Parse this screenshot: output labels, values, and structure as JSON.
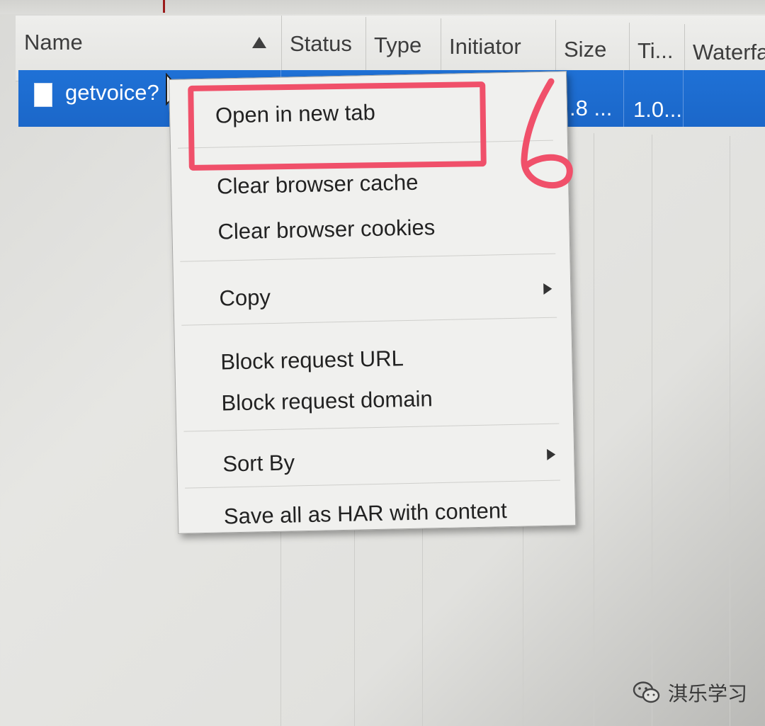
{
  "table": {
    "columns": [
      {
        "key": "name",
        "label": "Name"
      },
      {
        "key": "status",
        "label": "Status"
      },
      {
        "key": "type",
        "label": "Type"
      },
      {
        "key": "initiator",
        "label": "Initiator"
      },
      {
        "key": "size",
        "label": "Size"
      },
      {
        "key": "time",
        "label": "Ti..."
      },
      {
        "key": "waterfall",
        "label": "Waterfa"
      }
    ],
    "selected_row": {
      "name": "getvoice?",
      "size": ".8 ...",
      "time": "1.0..."
    }
  },
  "context_menu": {
    "items": [
      {
        "label": "Open in new tab"
      },
      {
        "label": "Clear browser cache"
      },
      {
        "label": "Clear browser cookies"
      },
      {
        "label": "Copy"
      },
      {
        "label": "Block request URL"
      },
      {
        "label": "Block request domain"
      },
      {
        "label": "Sort By"
      },
      {
        "label": "Save all as HAR with content"
      }
    ]
  },
  "annotation": {
    "color": "#f0506a"
  },
  "watermark": {
    "text": "淇乐学习"
  },
  "colors": {
    "selection": "#1f71d6",
    "annotation": "#f0506a"
  }
}
